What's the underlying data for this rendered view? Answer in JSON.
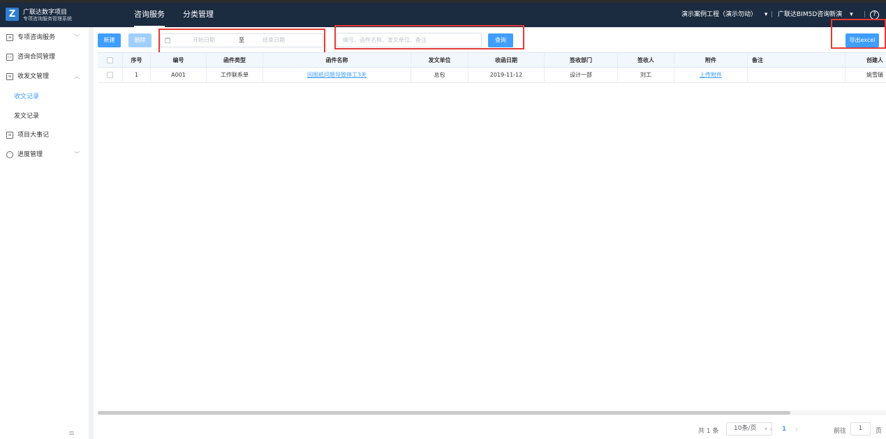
{
  "header": {
    "logo_letter": "Z",
    "title": "广联达数字项目",
    "subtitle": "专项咨询服务管理系统",
    "nav": [
      {
        "label": "咨询服务",
        "active": true
      },
      {
        "label": "分类管理",
        "active": false
      }
    ],
    "project": "演示案例工程（演示勿动）",
    "project_dropdown": "▾",
    "separator": "|",
    "company": "广联达BIM5D咨询新演",
    "company_dropdown": "▾",
    "help_icon_glyph": "?"
  },
  "sidebar": {
    "items": [
      {
        "label": "专项咨询服务",
        "icon": "list-icon",
        "chevron": "﹀"
      },
      {
        "label": "咨询合同管理",
        "icon": "contract-icon",
        "chevron": ""
      },
      {
        "label": "收发文管理",
        "icon": "document-icon",
        "chevron": "︿"
      },
      {
        "label": "项目大事记",
        "icon": "notebook-icon",
        "chevron": ""
      },
      {
        "label": "进度管理",
        "icon": "clock-icon",
        "chevron": "﹀"
      }
    ],
    "sub_items": [
      {
        "label": "收文记录",
        "active": true
      },
      {
        "label": "发文记录",
        "active": false
      }
    ],
    "collapse_glyph": "≡"
  },
  "toolbar": {
    "new_label": "新建",
    "delete_label": "删除",
    "start_date_placeholder": "开始日期",
    "to_label": "至",
    "end_date_placeholder": "结束日期",
    "search_placeholder": "编号、函件名称、发文单位、备注",
    "query_label": "查询",
    "export_label": "导出excel"
  },
  "table": {
    "columns": [
      "",
      "序号",
      "编号",
      "函件类型",
      "函件名称",
      "发文单位",
      "收函日期",
      "签收部门",
      "签收人",
      "附件",
      "备注",
      "创建人"
    ],
    "rows": [
      {
        "no": "1",
        "code": "A001",
        "type": "工作联系单",
        "name": "因图纸问题导致停工3天",
        "sender": "总包",
        "date": "2019-11-12",
        "dept": "设计一部",
        "receiver": "刘工",
        "attachment": "上传附件",
        "remark": "",
        "creator": "姚雪瑞"
      }
    ]
  },
  "pagination": {
    "total": "共 1 条",
    "page_size": "10条/页",
    "dropdown": "▾",
    "prev": "‹",
    "current": "1",
    "next": "›",
    "goto_label": "前往",
    "goto_value": "1",
    "page_suffix": "页"
  },
  "colors": {
    "header_bg": "#1b2b40",
    "accent": "#409eff",
    "highlight_box": "#e53935"
  }
}
